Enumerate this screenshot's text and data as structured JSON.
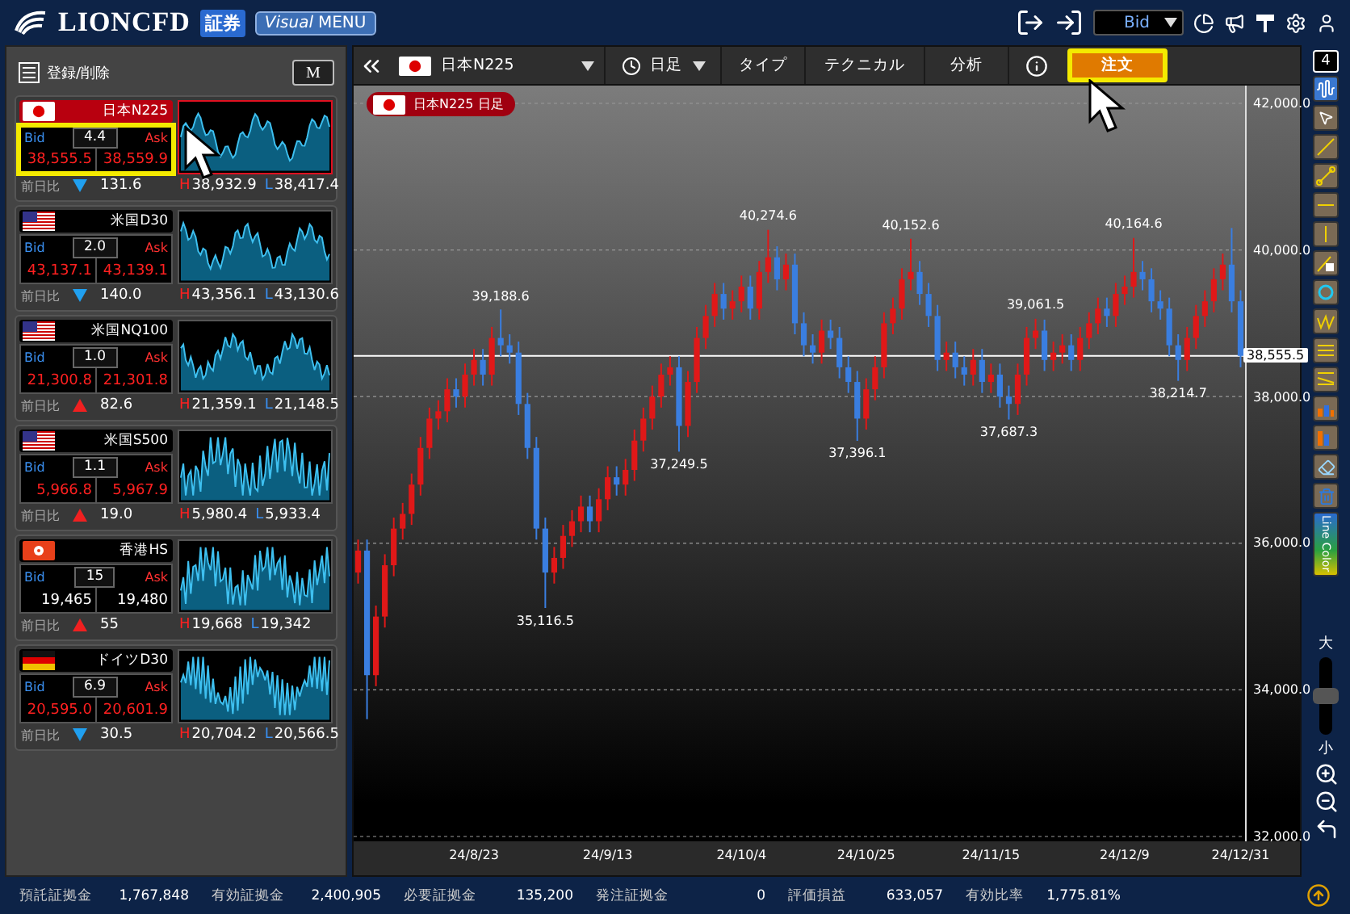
{
  "header": {
    "logo": "LIONCFD",
    "badge": "証券",
    "menu_button": {
      "italic": "Visual",
      "label": "MENU"
    },
    "price_select": "Bid"
  },
  "watchlist": {
    "edit_label": "登録/削除",
    "m_button": "M",
    "items": [
      {
        "name": "日本N225",
        "kind": "jp",
        "selected": true,
        "highlighted": true,
        "bid_label": "Bid",
        "ask_label": "Ask",
        "spread": "4.4",
        "bid": "38,555.5",
        "ask": "38,559.9",
        "down_tick": true,
        "change_label": "前日比",
        "rising": false,
        "change": "131.6",
        "high_label": "H",
        "high": "38,932.9",
        "low_label": "L",
        "low": "38,417.4"
      },
      {
        "name": "米国D30",
        "kind": "us",
        "selected": false,
        "highlighted": false,
        "bid_label": "Bid",
        "ask_label": "Ask",
        "spread": "2.0",
        "bid": "43,137.1",
        "ask": "43,139.1",
        "down_tick": true,
        "change_label": "前日比",
        "rising": false,
        "change": "140.0",
        "high_label": "H",
        "high": "43,356.1",
        "low_label": "L",
        "low": "43,130.6"
      },
      {
        "name": "米国NQ100",
        "kind": "us",
        "selected": false,
        "highlighted": false,
        "bid_label": "Bid",
        "ask_label": "Ask",
        "spread": "1.0",
        "bid": "21,300.8",
        "ask": "21,301.8",
        "down_tick": true,
        "change_label": "前日比",
        "rising": true,
        "change": "82.6",
        "high_label": "H",
        "high": "21,359.1",
        "low_label": "L",
        "low": "21,148.5"
      },
      {
        "name": "米国S500",
        "kind": "us",
        "selected": false,
        "highlighted": false,
        "bid_label": "Bid",
        "ask_label": "Ask",
        "spread": "1.1",
        "bid": "5,966.8",
        "ask": "5,967.9",
        "down_tick": true,
        "change_label": "前日比",
        "rising": true,
        "change": "19.0",
        "high_label": "H",
        "high": "5,980.4",
        "low_label": "L",
        "low": "5,933.4"
      },
      {
        "name": "香港HS",
        "kind": "hk",
        "selected": false,
        "highlighted": false,
        "bid_label": "Bid",
        "ask_label": "Ask",
        "spread": "15",
        "bid": "19,465",
        "ask": "19,480",
        "down_tick": false,
        "change_label": "前日比",
        "rising": true,
        "change": "55",
        "high_label": "H",
        "high": "19,668",
        "low_label": "L",
        "low": "19,342"
      },
      {
        "name": "ドイツD30",
        "kind": "de",
        "selected": false,
        "highlighted": false,
        "bid_label": "Bid",
        "ask_label": "Ask",
        "spread": "6.9",
        "bid": "20,595.0",
        "ask": "20,601.9",
        "down_tick": true,
        "change_label": "前日比",
        "rising": false,
        "change": "30.5",
        "high_label": "H",
        "high": "20,704.2",
        "low_label": "L",
        "low": "20,566.5"
      }
    ]
  },
  "chart_toolbar": {
    "symbol": "日本N225",
    "timeframe": "日足",
    "buttons": [
      "タイプ",
      "テクニカル",
      "分析"
    ],
    "order_button": {
      "label": "注文",
      "highlighted": true
    }
  },
  "chart": {
    "legend": "日本N225 日足",
    "current_price": "38,555.5",
    "chart_data": {
      "type": "candlestick",
      "ylim": [
        32000,
        42000
      ],
      "grid": true,
      "ref_lines": [
        {
          "axis": "y",
          "value": 38555.5
        }
      ],
      "yticks": [
        {
          "value": 42000,
          "label": "42,000.0"
        },
        {
          "value": 40000,
          "label": "40,000.0"
        },
        {
          "value": 38000,
          "label": "38,000.0"
        },
        {
          "value": 36000,
          "label": "36,000.0"
        },
        {
          "value": 34000,
          "label": "34,000.0"
        },
        {
          "value": 32000,
          "label": "32,000.0"
        }
      ],
      "categories": [
        null,
        null,
        null,
        null,
        null,
        null,
        null,
        null,
        null,
        null,
        null,
        null,
        null,
        "24/8/23",
        null,
        null,
        null,
        null,
        null,
        null,
        null,
        null,
        null,
        null,
        null,
        null,
        null,
        null,
        "24/9/13",
        null,
        null,
        null,
        null,
        null,
        null,
        null,
        null,
        null,
        null,
        null,
        null,
        null,
        null,
        "24/10/4",
        null,
        null,
        null,
        null,
        null,
        null,
        null,
        null,
        null,
        null,
        null,
        null,
        null,
        "24/10/25",
        null,
        null,
        null,
        null,
        null,
        null,
        null,
        null,
        null,
        null,
        null,
        null,
        null,
        "24/11/15",
        null,
        null,
        null,
        null,
        null,
        null,
        null,
        null,
        null,
        null,
        null,
        null,
        null,
        null,
        "24/12/9",
        null,
        null,
        null,
        null,
        null,
        null,
        null,
        null,
        null,
        null,
        null,
        null,
        "24/12/31"
      ],
      "ohlc": [
        [
          35600,
          36050,
          35450,
          35900
        ],
        [
          35900,
          36050,
          33600,
          34200
        ],
        [
          34200,
          35150,
          34050,
          35000
        ],
        [
          35000,
          35850,
          34850,
          35700
        ],
        [
          35700,
          36350,
          35550,
          36200
        ],
        [
          36200,
          36550,
          36050,
          36400
        ],
        [
          36400,
          36950,
          36250,
          36800
        ],
        [
          36800,
          37450,
          36650,
          37300
        ],
        [
          37300,
          37850,
          37150,
          37700
        ],
        [
          37700,
          37950,
          37550,
          37800
        ],
        [
          37800,
          38250,
          37650,
          38100
        ],
        [
          38100,
          38250,
          37850,
          38000
        ],
        [
          38000,
          38450,
          37850,
          38300
        ],
        [
          38300,
          38650,
          38150,
          38500
        ],
        [
          38500,
          38650,
          38150,
          38300
        ],
        [
          38300,
          38950,
          38150,
          38800
        ],
        [
          38800,
          39188.6,
          38550,
          38700
        ],
        [
          38700,
          38850,
          38450,
          38600
        ],
        [
          38600,
          38750,
          37750,
          37900
        ],
        [
          37900,
          38050,
          37150,
          37300
        ],
        [
          37300,
          37450,
          36050,
          36200
        ],
        [
          36200,
          36350,
          35116.5,
          35600
        ],
        [
          35600,
          35950,
          35450,
          35800
        ],
        [
          35800,
          36250,
          35650,
          36100
        ],
        [
          36100,
          36450,
          35950,
          36300
        ],
        [
          36300,
          36650,
          36150,
          36500
        ],
        [
          36500,
          36650,
          36150,
          36300
        ],
        [
          36300,
          36750,
          36150,
          36600
        ],
        [
          36600,
          37050,
          36450,
          36900
        ],
        [
          36900,
          37050,
          36650,
          36800
        ],
        [
          36800,
          37150,
          36650,
          37000
        ],
        [
          37000,
          37550,
          36850,
          37400
        ],
        [
          37400,
          37850,
          37250,
          37700
        ],
        [
          37700,
          38150,
          37550,
          38000
        ],
        [
          38000,
          38450,
          37850,
          38300
        ],
        [
          38300,
          38550,
          38150,
          38400
        ],
        [
          38400,
          38550,
          37249.5,
          37600
        ],
        [
          37600,
          38350,
          37450,
          38200
        ],
        [
          38200,
          38950,
          38050,
          38800
        ],
        [
          38800,
          39250,
          38650,
          39100
        ],
        [
          39100,
          39550,
          38950,
          39400
        ],
        [
          39400,
          39550,
          39050,
          39200
        ],
        [
          39200,
          39450,
          39050,
          39300
        ],
        [
          39300,
          39650,
          39150,
          39500
        ],
        [
          39500,
          39650,
          39050,
          39200
        ],
        [
          39200,
          39850,
          39050,
          39700
        ],
        [
          39700,
          40274.6,
          39550,
          39900
        ],
        [
          39900,
          40050,
          39450,
          39600
        ],
        [
          39600,
          39950,
          39450,
          39800
        ],
        [
          39800,
          39950,
          38850,
          39000
        ],
        [
          39000,
          39150,
          38550,
          38700
        ],
        [
          38700,
          38850,
          38450,
          38600
        ],
        [
          38600,
          39050,
          38450,
          38900
        ],
        [
          38900,
          39050,
          38650,
          38800
        ],
        [
          38800,
          38950,
          38250,
          38400
        ],
        [
          38400,
          38550,
          38050,
          38200
        ],
        [
          38200,
          38350,
          37396.1,
          37700
        ],
        [
          37700,
          38250,
          37550,
          38100
        ],
        [
          38100,
          38550,
          37950,
          38400
        ],
        [
          38400,
          39150,
          38250,
          39000
        ],
        [
          39000,
          39350,
          38850,
          39200
        ],
        [
          39200,
          39750,
          39050,
          39600
        ],
        [
          39600,
          40152.6,
          39450,
          39700
        ],
        [
          39700,
          39850,
          39250,
          39400
        ],
        [
          39400,
          39550,
          38950,
          39100
        ],
        [
          39100,
          39250,
          38350,
          38500
        ],
        [
          38500,
          38750,
          38350,
          38600
        ],
        [
          38600,
          38750,
          38250,
          38400
        ],
        [
          38400,
          38550,
          38150,
          38300
        ],
        [
          38300,
          38650,
          38150,
          38500
        ],
        [
          38500,
          38650,
          38050,
          38200
        ],
        [
          38200,
          38450,
          38050,
          38300
        ],
        [
          38300,
          38450,
          37850,
          38000
        ],
        [
          38000,
          38150,
          37687.3,
          37900
        ],
        [
          37900,
          38450,
          37750,
          38300
        ],
        [
          38300,
          38950,
          38150,
          38800
        ],
        [
          38800,
          39061.5,
          38650,
          38900
        ],
        [
          38900,
          39050,
          38350,
          38500
        ],
        [
          38500,
          38750,
          38350,
          38600
        ],
        [
          38600,
          38850,
          38450,
          38700
        ],
        [
          38700,
          38850,
          38350,
          38500
        ],
        [
          38500,
          38950,
          38350,
          38800
        ],
        [
          38800,
          39150,
          38650,
          39000
        ],
        [
          39000,
          39350,
          38850,
          39200
        ],
        [
          39200,
          39350,
          38950,
          39100
        ],
        [
          39100,
          39550,
          38950,
          39400
        ],
        [
          39400,
          39650,
          39250,
          39500
        ],
        [
          39500,
          40164.6,
          39350,
          39700
        ],
        [
          39700,
          39850,
          39450,
          39600
        ],
        [
          39600,
          39750,
          39150,
          39300
        ],
        [
          39300,
          39450,
          39050,
          39200
        ],
        [
          39200,
          39350,
          38550,
          38700
        ],
        [
          38700,
          38850,
          38214.7,
          38500
        ],
        [
          38500,
          38950,
          38350,
          38800
        ],
        [
          38800,
          39250,
          38650,
          39100
        ],
        [
          39100,
          39450,
          38950,
          39300
        ],
        [
          39300,
          39750,
          39150,
          39600
        ],
        [
          39600,
          39950,
          39450,
          39800
        ],
        [
          39800,
          40300,
          39150,
          39300
        ],
        [
          39300,
          39450,
          38400,
          38555.5
        ]
      ],
      "annotations": [
        {
          "y": 39188.6,
          "text": "39,188.6"
        },
        {
          "y": 35116.5,
          "text": "35,116.5"
        },
        {
          "y": 37249.5,
          "text": "37,249.5"
        },
        {
          "y": 40274.6,
          "text": "40,274.6"
        },
        {
          "y": 37396.1,
          "text": "37,396.1"
        },
        {
          "y": 40152.6,
          "text": "40,152.6"
        },
        {
          "y": 37687.3,
          "text": "37,687.3"
        },
        {
          "y": 39061.5,
          "text": "39,061.5"
        },
        {
          "y": 40164.6,
          "text": "40,164.6"
        },
        {
          "y": 38214.7,
          "text": "38,214.7"
        }
      ]
    }
  },
  "tools": {
    "layout_count": "4",
    "line_color_label": "Line Color",
    "zoom_large": "大",
    "zoom_small": "小",
    "zoom": {
      "level": 0.5
    }
  },
  "status_bar": [
    {
      "label": "預託証拠金",
      "value": "1,767,848"
    },
    {
      "label": "有効証拠金",
      "value": "2,400,905"
    },
    {
      "label": "必要証拠金",
      "value": "135,200"
    },
    {
      "label": "発注証拠金",
      "value": "0"
    },
    {
      "label": "評価損益",
      "value": "633,057"
    },
    {
      "label": "有効比率",
      "value": "1,775.81%"
    }
  ]
}
